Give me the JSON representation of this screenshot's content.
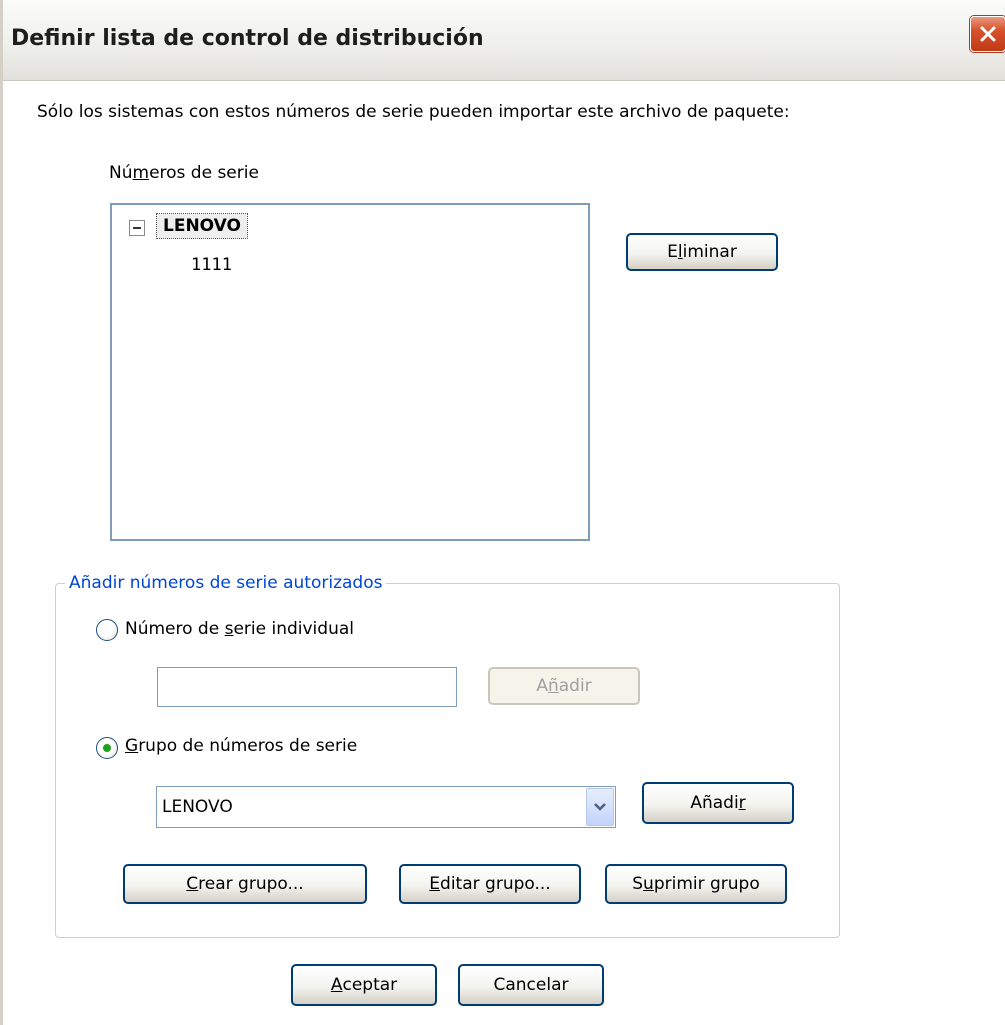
{
  "window": {
    "title": "Definir lista de control de distribución"
  },
  "intro_text": "Sólo los sistemas con estos números de serie pueden importar este archivo de paquete:",
  "serial_list": {
    "label_before": "Nú",
    "label_mnemonic": "m",
    "label_after": "eros de serie",
    "tree": {
      "root": "LENOVO",
      "children": [
        "1111"
      ]
    }
  },
  "delete_button": {
    "before": "E",
    "mnemonic": "l",
    "after": "iminar"
  },
  "add_group": {
    "legend": "Añadir números de serie autorizados",
    "individual": {
      "before": "Número de ",
      "mnemonic": "s",
      "after": "erie individual",
      "checked": false,
      "input_value": "",
      "add_button": {
        "before": "A",
        "mnemonic": "ñ",
        "after": "adir",
        "enabled": false
      }
    },
    "group": {
      "before": "",
      "mnemonic": "G",
      "after": "rupo de números de serie",
      "checked": true,
      "selected": "LENOVO",
      "add_button": {
        "before": "Añadi",
        "mnemonic": "r",
        "after": ""
      }
    },
    "create_button": {
      "before": "",
      "mnemonic": "C",
      "after": "rear grupo..."
    },
    "edit_button": {
      "before": "",
      "mnemonic": "E",
      "after": "ditar grupo..."
    },
    "remove_button": {
      "before": "S",
      "mnemonic": "u",
      "after": "primir grupo"
    }
  },
  "ok_button": {
    "before": "",
    "mnemonic": "A",
    "after": "ceptar"
  },
  "cancel_button": {
    "label": "Cancelar"
  },
  "icons": {
    "close": "close-icon",
    "dropdown": "chevron-down-icon",
    "tree_expander": "minus-box-icon"
  },
  "colors": {
    "accent_blue": "#0046d5",
    "close_red": "#c23a15",
    "radio_green": "#21a121",
    "button_border": "#003c74"
  }
}
